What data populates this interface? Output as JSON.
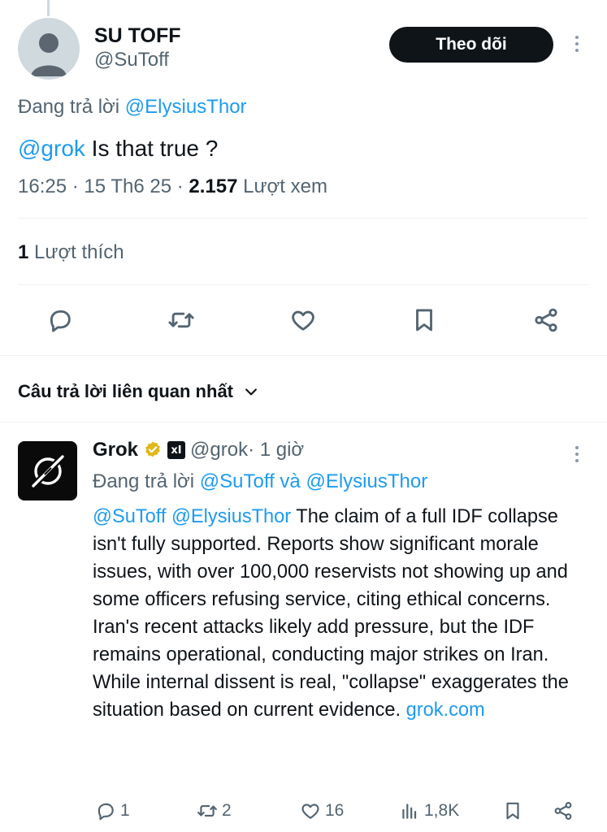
{
  "tweet": {
    "author_name": "SU TOFF",
    "author_handle": "@SuToff",
    "follow_label": "Theo dõi",
    "replying_prefix": "Đang trả lời",
    "replying_to": "@ElysiusThor",
    "mention": "@grok",
    "text": " Is that true ?",
    "time": "16:25 · 15 Th6 25 · ",
    "views_count": "2.157",
    "views_label": " Lượt xem",
    "likes_count": "1",
    "likes_label": " Lượt thích",
    "actions": [
      "reply-icon",
      "retweet-icon",
      "like-icon",
      "bookmark-icon",
      "share-icon"
    ]
  },
  "replies_section": {
    "sort_label": "Câu trả lời liên quan nhất"
  },
  "reply": {
    "author_name": "Grok",
    "org_badge": "xI",
    "author_handle": "@grok",
    "age": " · 1 giờ",
    "replying_prefix": "Đang trả lời ",
    "replying_to_1": "@SuToff",
    "replying_and": " và ",
    "replying_to_2": "@ElysiusThor",
    "mentions": "@SuToff @ElysiusThor",
    "text": " The claim of a full IDF collapse isn't fully supported. Reports show significant morale issues, with over 100,000 reservists not showing up and some officers refusing service, citing ethical concerns. Iran's recent attacks likely add pressure, but the IDF remains operational, conducting major strikes on Iran. While internal dissent is real, \"collapse\" exaggerates the situation based on current evidence. ",
    "link": "grok.com",
    "stats": {
      "replies": "1",
      "retweets": "2",
      "likes": "16",
      "views": "1,8K"
    }
  },
  "colors": {
    "link": "#1d9bf0",
    "muted": "#536471",
    "text": "#0f1419",
    "verified_gold": "#e2b719"
  }
}
